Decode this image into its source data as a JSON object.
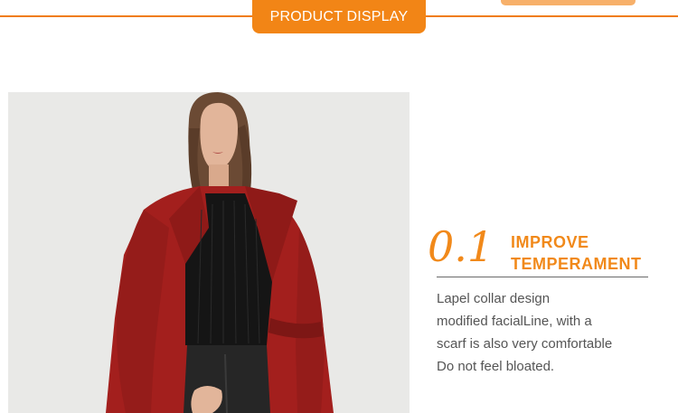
{
  "header": {
    "title": "PRODUCT DISPLAY"
  },
  "photo": {
    "icon": "woman-in-red-coat-photo"
  },
  "feature": {
    "number": "0.1",
    "heading_line1": "IMPROVE",
    "heading_line2": "TEMPERAMENT",
    "description": [
      "Lapel collar design",
      "modified facialLine, with a",
      "scarf is also very comfortable",
      "Do not feel bloated."
    ]
  },
  "colors": {
    "accent": "#f28516",
    "accent_light": "#f7b06a",
    "coat_red": "#a31f1d",
    "text_gray": "#555555"
  }
}
